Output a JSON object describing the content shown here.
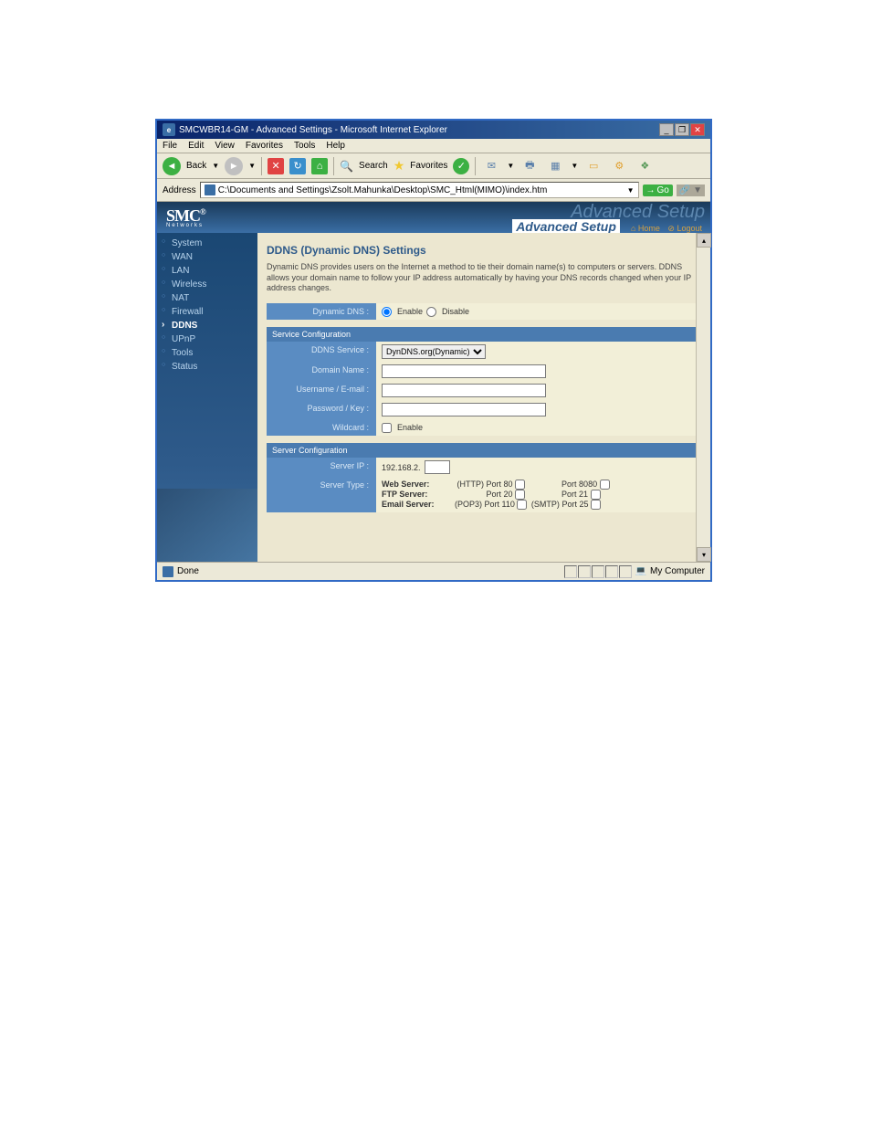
{
  "window": {
    "title": "SMCWBR14-GM - Advanced Settings - Microsoft Internet Explorer"
  },
  "menu": {
    "file": "File",
    "edit": "Edit",
    "view": "View",
    "favorites": "Favorites",
    "tools": "Tools",
    "help": "Help"
  },
  "toolbar": {
    "back": "Back",
    "search": "Search",
    "favorites": "Favorites"
  },
  "address": {
    "label": "Address",
    "value": "C:\\Documents and Settings\\Zsolt.Mahunka\\Desktop\\SMC_Html(MIMO)\\index.htm",
    "go": "Go"
  },
  "brand": {
    "logo": "SMC",
    "reg": "®",
    "sub": "Networks"
  },
  "banner": {
    "ghost": "Advanced Setup",
    "setup": "Advanced Setup",
    "home": "Home",
    "logout": "Logout"
  },
  "sidebar": {
    "items": [
      {
        "label": "System",
        "active": false
      },
      {
        "label": "WAN",
        "active": false
      },
      {
        "label": "LAN",
        "active": false
      },
      {
        "label": "Wireless",
        "active": false
      },
      {
        "label": "NAT",
        "active": false
      },
      {
        "label": "Firewall",
        "active": false
      },
      {
        "label": "DDNS",
        "active": true
      },
      {
        "label": "UPnP",
        "active": false
      },
      {
        "label": "Tools",
        "active": false
      },
      {
        "label": "Status",
        "active": false
      }
    ]
  },
  "page": {
    "title": "DDNS (Dynamic DNS) Settings",
    "desc": "Dynamic DNS provides users on the Internet a method to tie their domain name(s) to computers or servers. DDNS allows your domain name to follow your IP address automatically by having your DNS records changed when your IP address changes.",
    "dyn_label": "Dynamic DNS :",
    "enable": "Enable",
    "disable": "Disable",
    "svc_header": "Service Configuration",
    "ddns_service_label": "DDNS Service :",
    "ddns_service_value": "DynDNS.org(Dynamic)",
    "domain_label": "Domain Name :",
    "user_label": "Username / E-mail :",
    "pass_label": "Password / Key :",
    "wild_label": "Wildcard :",
    "srv_header": "Server Configuration",
    "srv_ip_label": "Server IP :",
    "srv_ip_prefix": "192.168.2.",
    "srv_type_label": "Server Type :",
    "web": "Web Server:",
    "web_proto": "(HTTP)",
    "port80": "Port 80",
    "port8080": "Port 8080",
    "ftp": "FTP Server:",
    "port20": "Port 20",
    "port21": "Port 21",
    "email": "Email Server:",
    "pop3": "(POP3)",
    "port110": "Port 110",
    "smtp": "(SMTP)",
    "port25": "Port 25"
  },
  "status": {
    "done": "Done",
    "zone": "My Computer"
  }
}
